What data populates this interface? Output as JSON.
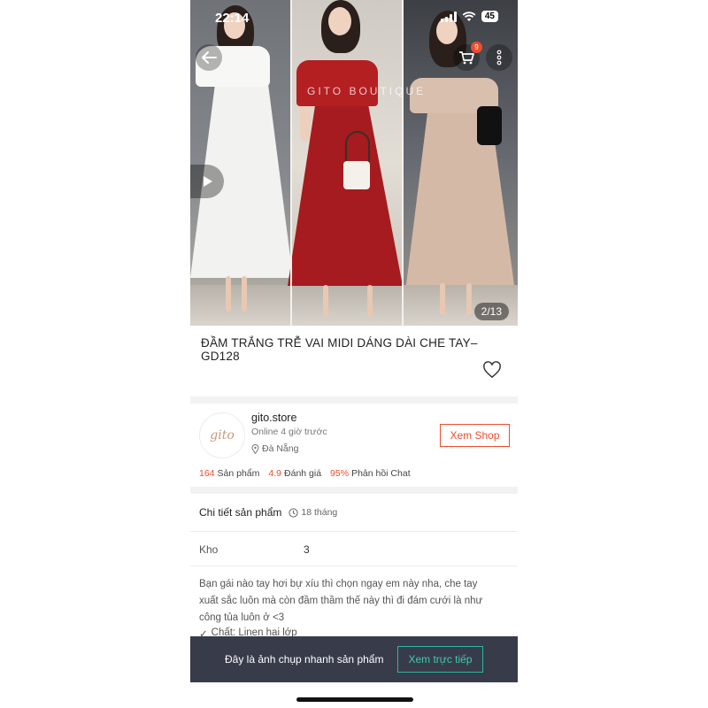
{
  "status": {
    "time": "22:14",
    "battery": "45"
  },
  "gallery": {
    "watermark": "GITO BOUTIQUE",
    "counter": "2/13"
  },
  "nav": {
    "back_icon": "arrow-left-icon",
    "cart_icon": "cart-icon",
    "cart_badge": "9",
    "more_icon": "more-vertical-icon"
  },
  "product": {
    "title": "ĐẦM TRẮNG TRỄ VAI MIDI DÁNG DÀI CHE TAY– GD128"
  },
  "shop": {
    "logo_text": "gito",
    "name": "gito.store",
    "online": "Online 4 giờ trước",
    "location": "Đà Nẵng",
    "view_button": "Xem Shop",
    "stats": [
      {
        "value": "164",
        "label": "Sản phẩm"
      },
      {
        "value": "4.9",
        "label": "Đánh giá"
      },
      {
        "value": "95%",
        "label": "Phản hồi Chat"
      }
    ]
  },
  "details": {
    "heading": "Chi tiết sản phẩm",
    "age": "18 tháng",
    "stock_label": "Kho",
    "stock_value": "3",
    "description": [
      "Bạn gái nào tay hơi bự xíu thì chọn ngay em này nha, che tay",
      "xuất sắc luôn mà còn đầm thầm thế này thì đi đám cưới là như",
      "công tủa luôn ở <3"
    ],
    "material": "Chất: Linen hai lớp"
  },
  "snapshot": {
    "text": "Đây là ảnh chụp nhanh sản phẩm",
    "live_button": "Xem trực tiếp"
  },
  "colors": {
    "accent": "#ee4d2d",
    "teal": "#2bb6a3",
    "bar": "#383c4a"
  }
}
